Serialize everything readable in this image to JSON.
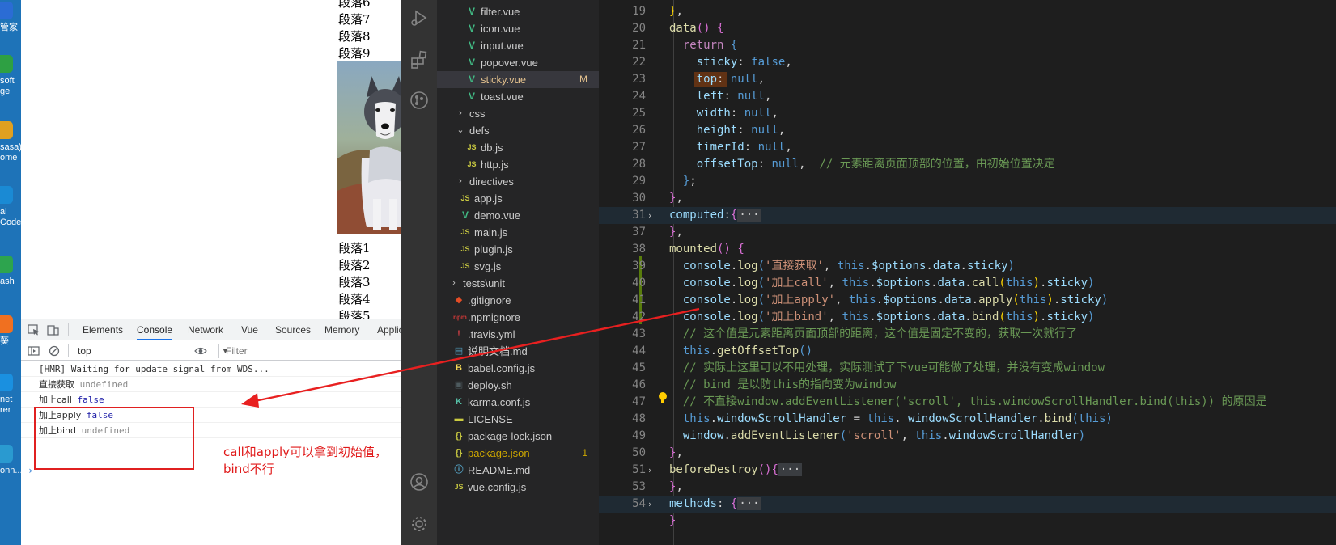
{
  "desktop": {
    "icons": [
      {
        "label": [
          "管家"
        ],
        "icon": "app-icon",
        "color": "#2b6cd4"
      },
      {
        "label": [
          "soft",
          "ge"
        ],
        "icon": "edge-icon",
        "color": "#2ea043"
      },
      {
        "label": [
          "sasa)",
          "ome"
        ],
        "icon": "chrome-icon",
        "color": "#e0a020"
      },
      {
        "label": [
          "al",
          "Code"
        ],
        "icon": "vscode-icon",
        "color": "#1a8ad4"
      },
      {
        "label": [
          "ash"
        ],
        "icon": "git-bash-icon",
        "color": "#2da44e"
      },
      {
        "label": [
          "葵"
        ],
        "icon": "app-icon",
        "color": "#f07020"
      },
      {
        "label": [
          "net",
          "rer"
        ],
        "icon": "ie-icon",
        "color": "#1a90e0"
      },
      {
        "label": [
          "onn..."
        ],
        "icon": "app-icon",
        "color": "#2a9ad0"
      }
    ]
  },
  "page": {
    "paragraphs_top": [
      "段落6",
      "段落7",
      "段落8",
      "段落9"
    ],
    "paragraphs_bottom": [
      "段落1",
      "段落2",
      "段落3",
      "段落4",
      "段落5"
    ]
  },
  "devtools": {
    "tabs": [
      "Elements",
      "Console",
      "Network",
      "Vue",
      "Sources",
      "Memory",
      "Applic"
    ],
    "active_tab": "Console",
    "context": "top",
    "filter_placeholder": "Filter",
    "console": [
      {
        "text": "[HMR] Waiting for update signal from WDS...",
        "value": "",
        "value_type": "none"
      },
      {
        "text": "直接获取",
        "value": "undefined",
        "value_type": "undef"
      },
      {
        "text": "加上call",
        "value": "false",
        "value_type": "bool"
      },
      {
        "text": "加上apply",
        "value": "false",
        "value_type": "bool"
      },
      {
        "text": "加上bind",
        "value": "undefined",
        "value_type": "undef"
      }
    ],
    "prompt": "›",
    "note": [
      "call和apply可以拿到初始值，",
      "bind不行"
    ]
  },
  "explorer": {
    "items": [
      {
        "name": "filter.vue",
        "type": "vue",
        "depth": 3
      },
      {
        "name": "icon.vue",
        "type": "vue",
        "depth": 3
      },
      {
        "name": "input.vue",
        "type": "vue",
        "depth": 3
      },
      {
        "name": "popover.vue",
        "type": "vue",
        "depth": 3
      },
      {
        "name": "sticky.vue",
        "type": "vue",
        "depth": 3,
        "selected": true,
        "badge": "M",
        "color": "#e2c08d"
      },
      {
        "name": "toast.vue",
        "type": "vue",
        "depth": 3
      },
      {
        "name": "css",
        "type": "folder-closed",
        "depth": 2
      },
      {
        "name": "defs",
        "type": "folder-open",
        "depth": 2
      },
      {
        "name": "db.js",
        "type": "js",
        "depth": 3
      },
      {
        "name": "http.js",
        "type": "js",
        "depth": 3
      },
      {
        "name": "directives",
        "type": "folder-closed",
        "depth": 2
      },
      {
        "name": "app.js",
        "type": "js",
        "depth": 2
      },
      {
        "name": "demo.vue",
        "type": "vue",
        "depth": 2
      },
      {
        "name": "main.js",
        "type": "js",
        "depth": 2
      },
      {
        "name": "plugin.js",
        "type": "js",
        "depth": 2
      },
      {
        "name": "svg.js",
        "type": "js",
        "depth": 2
      },
      {
        "name": "tests\\unit",
        "type": "folder-closed",
        "depth": 1
      },
      {
        "name": ".gitignore",
        "type": "git",
        "depth": 1
      },
      {
        "name": ".npmignore",
        "type": "npm",
        "depth": 1
      },
      {
        "name": ".travis.yml",
        "type": "travis",
        "depth": 1
      },
      {
        "name": "说明文档.md",
        "type": "md",
        "depth": 1
      },
      {
        "name": "babel.config.js",
        "type": "babel",
        "depth": 1
      },
      {
        "name": "deploy.sh",
        "type": "sh",
        "depth": 1
      },
      {
        "name": "karma.conf.js",
        "type": "karma",
        "depth": 1
      },
      {
        "name": "LICENSE",
        "type": "license",
        "depth": 1
      },
      {
        "name": "package-lock.json",
        "type": "json",
        "depth": 1
      },
      {
        "name": "package.json",
        "type": "json",
        "depth": 1,
        "badge": "1",
        "color": "#cca700"
      },
      {
        "name": "README.md",
        "type": "readme",
        "depth": 1
      },
      {
        "name": "vue.config.js",
        "type": "js",
        "depth": 1
      }
    ],
    "bottom_partial": "> ..."
  },
  "editor": {
    "lines": [
      {
        "n": "19",
        "html": "<span class=\"y\">}</span>,"
      },
      {
        "n": "20",
        "html": "<span class=\"f\">data</span><span class=\"b\">()</span> <span class=\"b\">{</span>"
      },
      {
        "n": "21",
        "html": "  <span class=\"kw\">return</span> <span class=\"k\">{</span>"
      },
      {
        "n": "22",
        "html": "    <span class=\"p\">sticky</span>: <span class=\"k\">false</span>,"
      },
      {
        "n": "23",
        "html": "    <span class=\"p\">top</span>: <span class=\"k\">null</span>,"
      },
      {
        "n": "24",
        "html": "    <span class=\"p\">left</span>: <span class=\"k\">null</span>,"
      },
      {
        "n": "25",
        "html": "    <span class=\"p\">width</span>: <span class=\"k\">null</span>,"
      },
      {
        "n": "26",
        "html": "    <span class=\"p\">height</span>: <span class=\"k\">null</span>,"
      },
      {
        "n": "27",
        "html": "    <span class=\"p\">timerId</span>: <span class=\"k\">null</span>,"
      },
      {
        "n": "28",
        "html": "    <span class=\"p\">offsetTop</span>: <span class=\"k\">null</span>,  <span class=\"c\">// <span class=\"cjk\">元素距离页面顶部的位置，由初始位置决定</span></span>"
      },
      {
        "n": "29",
        "html": "  <span class=\"k\">}</span>;"
      },
      {
        "n": "30",
        "html": "<span class=\"b\">}</span>,"
      },
      {
        "n": "31",
        "fold": "›",
        "highlight": true,
        "html": "<span class=\"p\">computed</span>:<span class=\"b\">{</span><span class=\"fold-dots\">···</span>"
      },
      {
        "n": "37",
        "html": "<span class=\"b\">}</span>,"
      },
      {
        "n": "38",
        "html": "<span class=\"f\">mounted</span><span class=\"b\">()</span> <span class=\"b\">{</span>"
      },
      {
        "n": "39",
        "html": "  <span class=\"p\">console</span>.<span class=\"f\">log</span><span class=\"k\">(</span><span class=\"s\">'<span class=\"cjk\">直接获取</span>'</span>, <span class=\"k\">this</span>.<span class=\"p\">$options</span>.<span class=\"p\">data</span>.<span class=\"p\">sticky</span><span class=\"k\">)</span>"
      },
      {
        "n": "40",
        "html": "  <span class=\"p\">console</span>.<span class=\"f\">log</span><span class=\"k\">(</span><span class=\"s\">'<span class=\"cjk\">加上</span>call'</span>, <span class=\"k\">this</span>.<span class=\"p\">$options</span>.<span class=\"p\">data</span>.<span class=\"f\">call</span><span class=\"y\">(</span><span class=\"k\">this</span><span class=\"y\">)</span>.<span class=\"p\">sticky</span><span class=\"k\">)</span>"
      },
      {
        "n": "41",
        "html": "  <span class=\"p\">console</span>.<span class=\"f\">log</span><span class=\"k\">(</span><span class=\"s\">'<span class=\"cjk\">加上</span>apply'</span>, <span class=\"k\">this</span>.<span class=\"p\">$options</span>.<span class=\"p\">data</span>.<span class=\"f\">apply</span><span class=\"y\">(</span><span class=\"k\">this</span><span class=\"y\">)</span>.<span class=\"p\">sticky</span><span class=\"k\">)</span>"
      },
      {
        "n": "42",
        "html": "  <span class=\"p\">console</span>.<span class=\"f\">log</span><span class=\"k\">(</span><span class=\"s\">'<span class=\"cjk\">加上</span>bind'</span>, <span class=\"k\">this</span>.<span class=\"p\">$options</span>.<span class=\"p\">data</span>.<span class=\"f\">bind</span><span class=\"y\">(</span><span class=\"k\">this</span><span class=\"y\">)</span>.<span class=\"p\">sticky</span><span class=\"k\">)</span>"
      },
      {
        "n": "43",
        "html": "  <span class=\"c\">// <span class=\"cjk\">这个值是元素距离页面顶部的距离，这个值是固定不变的，获取一次就行了</span></span>"
      },
      {
        "n": "44",
        "html": "  <span class=\"k\">this</span>.<span class=\"f\">getOffsetTop</span><span class=\"k\">()</span>"
      },
      {
        "n": "45",
        "html": "  <span class=\"c\">// <span class=\"cjk\">实际上这里可以不用处理，实际测试了下</span>vue<span class=\"cjk\">可能做了处理，并没有变成</span>window</span>"
      },
      {
        "n": "46",
        "html": "  <span class=\"c\">// bind <span class=\"cjk\">是以防</span>this<span class=\"cjk\">的指向变为</span>window</span>"
      },
      {
        "n": "47",
        "html": "  <span class=\"c\">// <span class=\"cjk\">不直接</span>window.addEventListener('scroll', this.windowScrollHandler.bind(this)) <span class=\"cjk\">的原因是</span></span>"
      },
      {
        "n": "48",
        "html": "  <span class=\"k\">this</span>.<span class=\"p\">windowScrollHandler</span> = <span class=\"k\">this</span>.<span class=\"p\">_windowScrollHandler</span>.<span class=\"f\">bind</span><span class=\"k\">(</span><span class=\"k\">this</span><span class=\"k\">)</span>"
      },
      {
        "n": "49",
        "html": "  <span class=\"p\">window</span>.<span class=\"f\">addEventListener</span><span class=\"k\">(</span><span class=\"s\">'scroll'</span>, <span class=\"k\">this</span>.<span class=\"p\">windowScrollHandler</span><span class=\"k\">)</span>"
      },
      {
        "n": "50",
        "html": "<span class=\"b\">}</span>,"
      },
      {
        "n": "51",
        "fold": "›",
        "html": "<span class=\"f\">beforeDestroy</span><span class=\"b\">()</span><span class=\"b\">{</span><span class=\"fold-dots\">···</span>"
      },
      {
        "n": "53",
        "html": "<span class=\"b\">}</span>,"
      },
      {
        "n": "54",
        "fold": "›",
        "highlight": true,
        "html": "<span class=\"p\">methods</span>: <span class=\"b\">{</span><span class=\"fold-dots\">···</span>"
      },
      {
        "n": "",
        "html": "<span class=\"b\">}</span>"
      }
    ]
  }
}
